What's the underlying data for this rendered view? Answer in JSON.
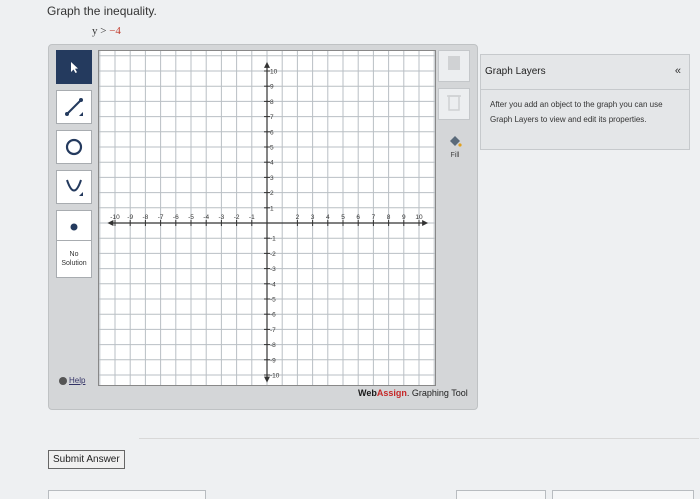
{
  "question": {
    "prompt": "Graph the inequality.",
    "var": "y",
    "op": ">",
    "rhs": "−4"
  },
  "toolbar": {
    "no_solution_line1": "No",
    "no_solution_line2": "Solution",
    "help_label": "Help"
  },
  "right_tools": {
    "fill_label": "Fill"
  },
  "graph": {
    "x_min": -10,
    "x_max": 10,
    "y_min": -10,
    "y_max": 10,
    "x_tick_labels": [
      "-10",
      "-9",
      "-8",
      "-7",
      "-6",
      "-5",
      "-4",
      "-3",
      "-2",
      "-1",
      "",
      "2",
      "3",
      "4",
      "5",
      "6",
      "7",
      "8",
      "9",
      "10"
    ],
    "y_tick_labels_pos": [
      "10",
      "9",
      "8",
      "7",
      "6",
      "5",
      "4",
      "3",
      "2",
      "1"
    ],
    "y_tick_labels_neg": [
      "-1",
      "-2",
      "-3",
      "-4",
      "-5",
      "-6",
      "-7",
      "-8",
      "-9",
      "-10"
    ]
  },
  "brand": {
    "web": "Web",
    "assign": "Assign",
    "rest": ". Graphing Tool"
  },
  "layers": {
    "title": "Graph Layers",
    "collapse": "«",
    "description": "After you add an object to the graph you can use Graph Layers to view and edit its properties."
  },
  "submit": {
    "label": "Submit Answer"
  },
  "colors": {
    "active_tool": "#243a5e",
    "brand_red": "#c62828"
  }
}
